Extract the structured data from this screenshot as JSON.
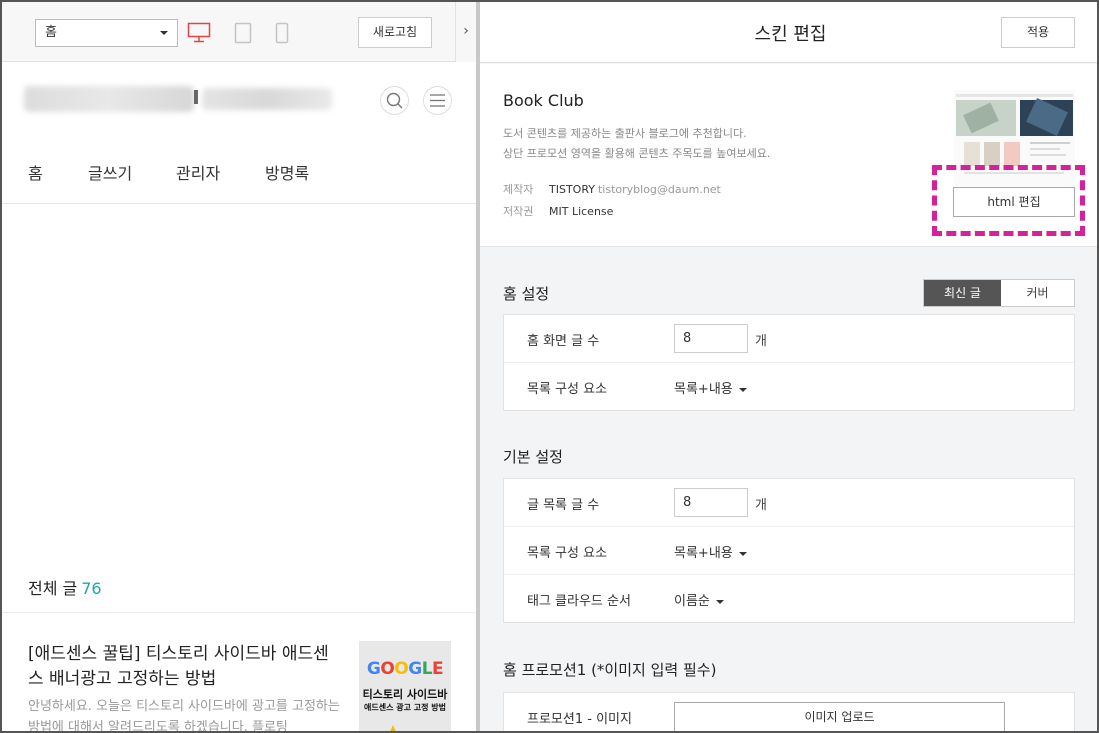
{
  "toolbar": {
    "page_select": "홈",
    "refresh_label": "새로고침",
    "collapse_arrow": "›",
    "device_icons": [
      "desktop-icon",
      "tablet-icon",
      "mobile-icon"
    ],
    "active_color": "#e84343"
  },
  "blog": {
    "nav": [
      "홈",
      "글쓰기",
      "관리자",
      "방명록"
    ],
    "total_label": "전체 글",
    "total_count": "76",
    "post": {
      "title": "[애드센스 꿀팁] 티스토리 사이드바 애드센스 배너광고 고정하는 방법",
      "excerpt": "안녕하세요. 오늘은 티스토리 사이드바에 광고를 고정하는 방법에 대해서 알려드리도록 하겠습니다. 플로팅",
      "thumb_word": "GOOGLE",
      "thumb_line1": "티스토리 사이드바",
      "thumb_line2": "애드센스 광고 고정 방법"
    }
  },
  "editor": {
    "title": "스킨 편집",
    "apply_label": "적용",
    "skin": {
      "name": "Book Club",
      "desc1": "도서 콘텐츠를 제공하는 출판사 블로그에 추천합니다.",
      "desc2": "상단 프로모션 영역을 활용해 콘텐츠 주목도를 높여보세요.",
      "maker_key": "제작자",
      "maker": "TISTORY",
      "maker_email": "tistoryblog@daum.net",
      "license_key": "저작권",
      "license": "MIT License",
      "html_edit_label": "html 편집",
      "highlight_color": "#d6229a"
    },
    "home": {
      "title": "홈 설정",
      "tab_active": "최신 글",
      "tab_other": "커버",
      "count_label": "홈 화면 글 수",
      "count_value": "8",
      "count_unit": "개",
      "list_label": "목록 구성 요소",
      "list_value": "목록+내용"
    },
    "basic": {
      "title": "기본 설정",
      "count_label": "글 목록 글 수",
      "count_value": "8",
      "count_unit": "개",
      "list_label": "목록 구성 요소",
      "list_value": "목록+내용",
      "tag_label": "태그 클라우드 순서",
      "tag_value": "이름순"
    },
    "promo": {
      "title": "홈 프로모션1 (*이미지 입력 필수)",
      "image_label": "프로모션1 - 이미지",
      "upload_label": "이미지 업로드"
    }
  }
}
